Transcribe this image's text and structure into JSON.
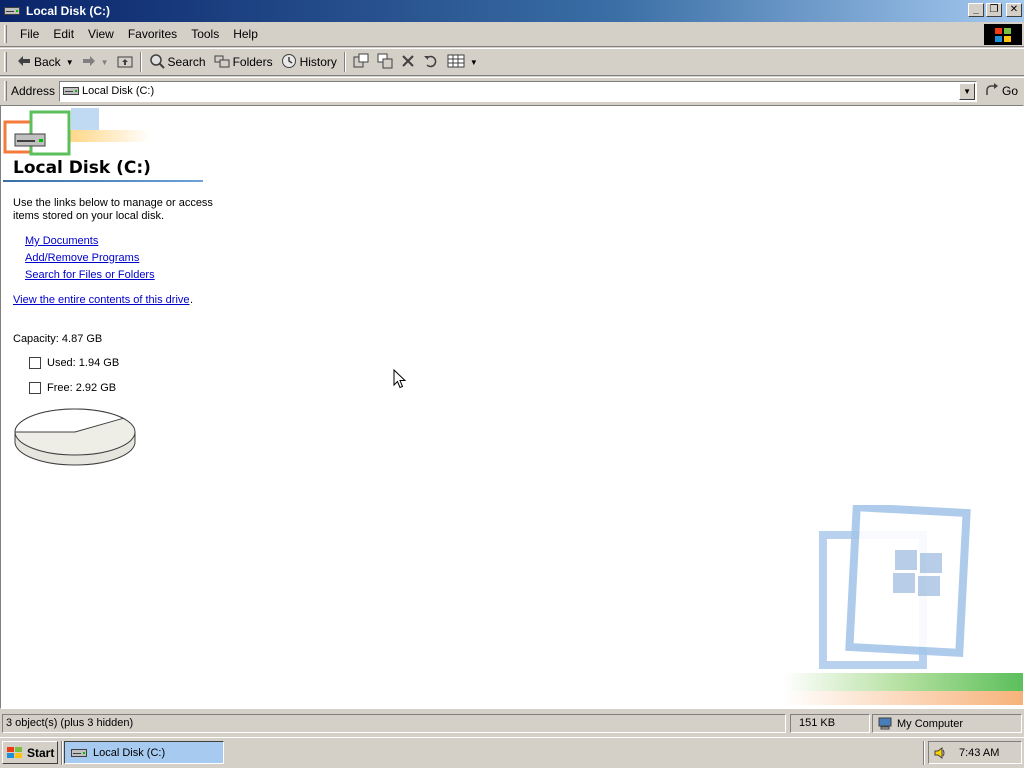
{
  "window": {
    "title": "Local Disk (C:)",
    "buttons": {
      "minimize": "_",
      "restore": "❐",
      "close": "✕"
    }
  },
  "menu": {
    "items": [
      "File",
      "Edit",
      "View",
      "Favorites",
      "Tools",
      "Help"
    ]
  },
  "toolbar": {
    "back": "Back",
    "search": "Search",
    "folders": "Folders",
    "history": "History"
  },
  "address": {
    "label": "Address",
    "value": "Local Disk (C:)",
    "go": "Go"
  },
  "panel": {
    "heading": "Local Disk (C:)",
    "description": "Use the links below to manage or access items stored on your local disk.",
    "links": [
      "My Documents",
      "Add/Remove Programs",
      "Search for Files or Folders"
    ],
    "view_contents_link": "View the entire contents of this drive",
    "view_contents_suffix": ".",
    "capacity": "Capacity: 4.87 GB",
    "used": "Used: 1.94 GB",
    "free": "Free: 2.92 GB",
    "used_fraction": 0.3984,
    "colors": {
      "used_slice": "#ffffff",
      "free_slice": "#eeede6"
    }
  },
  "status": {
    "objects": "3 object(s) (plus 3 hidden)",
    "size": "151 KB",
    "zone": "My Computer"
  },
  "taskbar": {
    "start": "Start",
    "task": "Local Disk (C:)",
    "clock": "7:43 AM"
  }
}
